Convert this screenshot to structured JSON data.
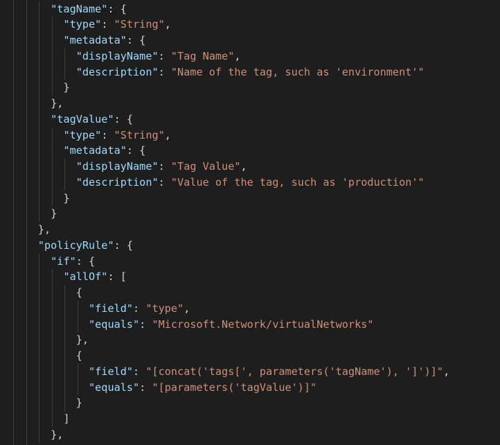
{
  "editor": {
    "language": "json",
    "colors": {
      "background": "#1e1e1e",
      "key": "#9cdcfe",
      "string": "#ce9178",
      "punctuation": "#d4d4d4",
      "indent_guide": "#404040"
    },
    "lines": [
      {
        "indent": 4,
        "tokens": [
          [
            "k",
            "\"tagName\""
          ],
          [
            "p",
            ": {"
          ]
        ]
      },
      {
        "indent": 5,
        "tokens": [
          [
            "k",
            "\"type\""
          ],
          [
            "p",
            ": "
          ],
          [
            "s",
            "\"String\""
          ],
          [
            "p",
            ","
          ]
        ]
      },
      {
        "indent": 5,
        "tokens": [
          [
            "k",
            "\"metadata\""
          ],
          [
            "p",
            ": {"
          ]
        ]
      },
      {
        "indent": 6,
        "tokens": [
          [
            "k",
            "\"displayName\""
          ],
          [
            "p",
            ": "
          ],
          [
            "s",
            "\"Tag Name\""
          ],
          [
            "p",
            ","
          ]
        ]
      },
      {
        "indent": 6,
        "tokens": [
          [
            "k",
            "\"description\""
          ],
          [
            "p",
            ": "
          ],
          [
            "s",
            "\"Name of the tag, such as 'environment'\""
          ]
        ]
      },
      {
        "indent": 5,
        "tokens": [
          [
            "p",
            "}"
          ]
        ]
      },
      {
        "indent": 4,
        "tokens": [
          [
            "p",
            "},"
          ]
        ]
      },
      {
        "indent": 4,
        "tokens": [
          [
            "k",
            "\"tagValue\""
          ],
          [
            "p",
            ": {"
          ]
        ]
      },
      {
        "indent": 5,
        "tokens": [
          [
            "k",
            "\"type\""
          ],
          [
            "p",
            ": "
          ],
          [
            "s",
            "\"String\""
          ],
          [
            "p",
            ","
          ]
        ]
      },
      {
        "indent": 5,
        "tokens": [
          [
            "k",
            "\"metadata\""
          ],
          [
            "p",
            ": {"
          ]
        ]
      },
      {
        "indent": 6,
        "tokens": [
          [
            "k",
            "\"displayName\""
          ],
          [
            "p",
            ": "
          ],
          [
            "s",
            "\"Tag Value\""
          ],
          [
            "p",
            ","
          ]
        ]
      },
      {
        "indent": 6,
        "tokens": [
          [
            "k",
            "\"description\""
          ],
          [
            "p",
            ": "
          ],
          [
            "s",
            "\"Value of the tag, such as 'production'\""
          ]
        ]
      },
      {
        "indent": 5,
        "tokens": [
          [
            "p",
            "}"
          ]
        ]
      },
      {
        "indent": 4,
        "tokens": [
          [
            "p",
            "}"
          ]
        ]
      },
      {
        "indent": 3,
        "tokens": [
          [
            "p",
            "},"
          ]
        ]
      },
      {
        "indent": 3,
        "tokens": [
          [
            "k",
            "\"policyRule\""
          ],
          [
            "p",
            ": {"
          ]
        ]
      },
      {
        "indent": 4,
        "tokens": [
          [
            "k",
            "\"if\""
          ],
          [
            "p",
            ": {"
          ]
        ]
      },
      {
        "indent": 5,
        "tokens": [
          [
            "k",
            "\"allOf\""
          ],
          [
            "p",
            ": ["
          ]
        ]
      },
      {
        "indent": 6,
        "tokens": [
          [
            "p",
            "{"
          ]
        ]
      },
      {
        "indent": 7,
        "tokens": [
          [
            "k",
            "\"field\""
          ],
          [
            "p",
            ": "
          ],
          [
            "s",
            "\"type\""
          ],
          [
            "p",
            ","
          ]
        ]
      },
      {
        "indent": 7,
        "tokens": [
          [
            "k",
            "\"equals\""
          ],
          [
            "p",
            ": "
          ],
          [
            "s",
            "\"Microsoft.Network/virtualNetworks\""
          ]
        ]
      },
      {
        "indent": 6,
        "tokens": [
          [
            "p",
            "},"
          ]
        ]
      },
      {
        "indent": 6,
        "tokens": [
          [
            "p",
            "{"
          ]
        ]
      },
      {
        "indent": 7,
        "tokens": [
          [
            "k",
            "\"field\""
          ],
          [
            "p",
            ": "
          ],
          [
            "s",
            "\"[concat('tags[', parameters('tagName'), ']')]\""
          ],
          [
            "p",
            ","
          ]
        ]
      },
      {
        "indent": 7,
        "tokens": [
          [
            "k",
            "\"equals\""
          ],
          [
            "p",
            ": "
          ],
          [
            "s",
            "\"[parameters('tagValue')]\""
          ]
        ]
      },
      {
        "indent": 6,
        "tokens": [
          [
            "p",
            "}"
          ]
        ]
      },
      {
        "indent": 5,
        "tokens": [
          [
            "p",
            "]"
          ]
        ]
      },
      {
        "indent": 4,
        "tokens": [
          [
            "p",
            "},"
          ]
        ]
      }
    ]
  }
}
